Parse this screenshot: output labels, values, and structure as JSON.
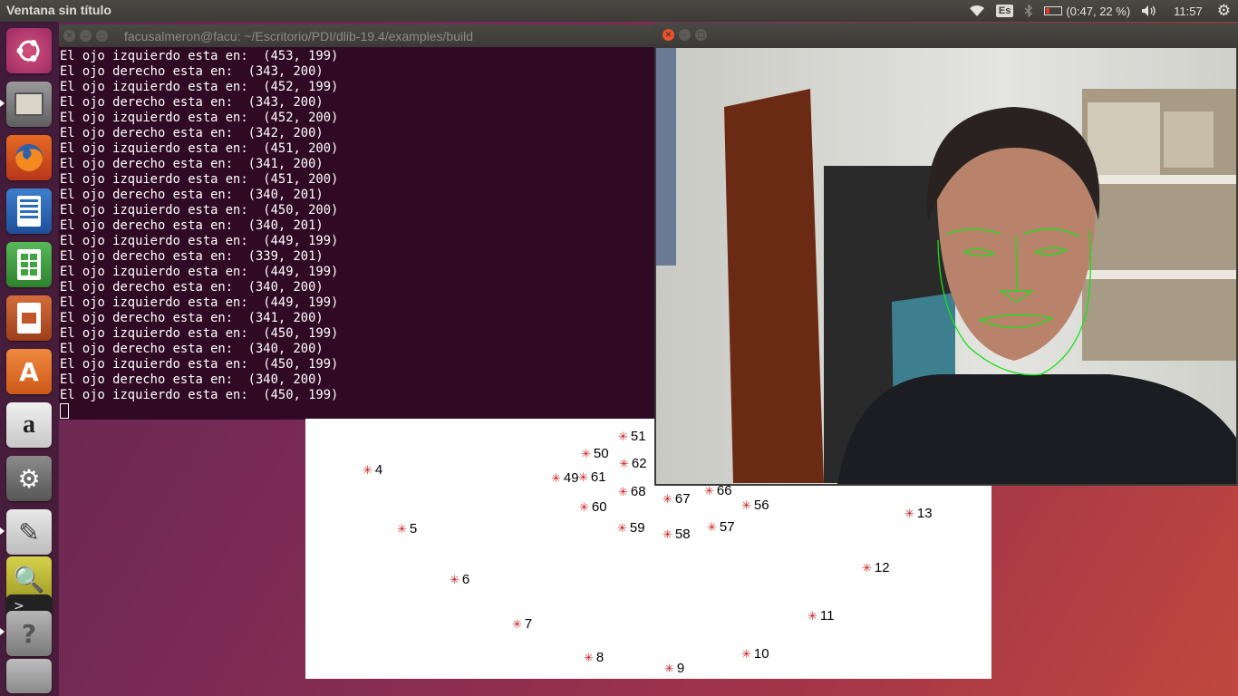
{
  "top_panel": {
    "app_title": "Ventana sin título",
    "keyboard_layout": "Es",
    "battery_text": "(0:47, 22 %)",
    "battery_level": 0.22,
    "clock": "11:57",
    "icons": [
      "wifi-icon",
      "bluetooth-icon",
      "battery-icon",
      "volume-icon",
      "gear-icon"
    ]
  },
  "launcher": {
    "items": [
      {
        "name": "ubuntu-dash-icon",
        "color": "#e95420"
      },
      {
        "name": "files-icon",
        "color": "#8a8a8a"
      },
      {
        "name": "firefox-icon",
        "color": "#e66000"
      },
      {
        "name": "writer-icon",
        "color": "#2a6ebb"
      },
      {
        "name": "calc-icon",
        "color": "#3fa33f"
      },
      {
        "name": "impress-icon",
        "color": "#c0572a"
      },
      {
        "name": "software-center-icon",
        "color": "#e8762b"
      },
      {
        "name": "amazon-icon",
        "color": "#dddddd"
      },
      {
        "name": "system-settings-icon",
        "color": "#7b7b7b"
      },
      {
        "name": "text-editor-icon",
        "color": "#d7d7d7"
      },
      {
        "name": "image-viewer-icon",
        "color": "#c5c045"
      },
      {
        "name": "terminal-icon",
        "color": "#333333"
      },
      {
        "name": "help-icon",
        "color": "#9a9a9a"
      },
      {
        "name": "workspace-switcher-icon",
        "color": "#aaaaaa"
      }
    ]
  },
  "terminal": {
    "title": "facusalmeron@facu: ~/Escritorio/PDI/dlib-19.4/examples/build",
    "lines": [
      "El ojo izquierdo esta en:  (453, 199)",
      "El ojo derecho esta en:  (343, 200)",
      "El ojo izquierdo esta en:  (452, 199)",
      "El ojo derecho esta en:  (343, 200)",
      "El ojo izquierdo esta en:  (452, 200)",
      "El ojo derecho esta en:  (342, 200)",
      "El ojo izquierdo esta en:  (451, 200)",
      "El ojo derecho esta en:  (341, 200)",
      "El ojo izquierdo esta en:  (451, 200)",
      "El ojo derecho esta en:  (340, 201)",
      "El ojo izquierdo esta en:  (450, 200)",
      "El ojo derecho esta en:  (340, 201)",
      "El ojo izquierdo esta en:  (449, 199)",
      "El ojo derecho esta en:  (339, 201)",
      "El ojo izquierdo esta en:  (449, 199)",
      "El ojo derecho esta en:  (340, 200)",
      "El ojo izquierdo esta en:  (449, 199)",
      "El ojo derecho esta en:  (341, 200)",
      "El ojo izquierdo esta en:  (450, 199)",
      "El ojo derecho esta en:  (340, 200)",
      "El ojo izquierdo esta en:  (450, 199)",
      "El ojo derecho esta en:  (340, 200)",
      "El ojo izquierdo esta en:  (450, 199)"
    ]
  },
  "landmarks": {
    "labels": [
      "4",
      "50",
      "51",
      "62",
      "49",
      "61",
      "68",
      "67",
      "66",
      "56",
      "60",
      "59",
      "58",
      "57",
      "13",
      "5",
      "12",
      "6",
      "11",
      "7",
      "8",
      "10",
      "9"
    ],
    "marker_color": "#d01c1c"
  },
  "webcam": {
    "overlay_color": "#19e019"
  }
}
